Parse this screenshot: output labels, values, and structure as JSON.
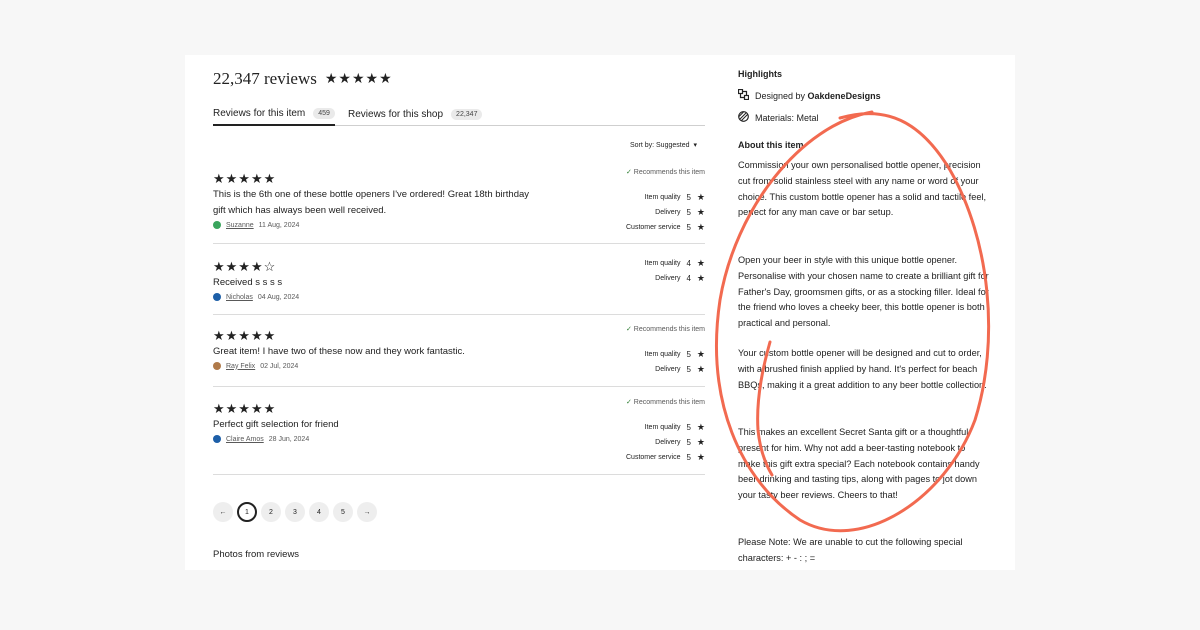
{
  "reviews": {
    "total_label": "22,347 reviews",
    "total_stars": "★★★★★",
    "tabs": [
      {
        "label": "Reviews for this item",
        "count": "459"
      },
      {
        "label": "Reviews for this shop",
        "count": "22,347"
      }
    ],
    "sort_label": "Sort by: Suggested",
    "sort_icon": "▾",
    "items": [
      {
        "stars": "★★★★★",
        "text": "This is the 6th one of these bottle openers I've ordered! Great 18th birthday gift which has always been well received.",
        "author": "Suzanne",
        "date": "11 Aug, 2024",
        "recommends": "Recommends this item",
        "ratings": [
          {
            "label": "Item quality",
            "value": "5"
          },
          {
            "label": "Delivery",
            "value": "5"
          },
          {
            "label": "Customer service",
            "value": "5"
          }
        ]
      },
      {
        "stars": "★★★★☆",
        "text": "Received s s s s",
        "author": "Nicholas",
        "date": "04 Aug, 2024",
        "ratings": [
          {
            "label": "Item quality",
            "value": "4"
          },
          {
            "label": "Delivery",
            "value": "4"
          }
        ]
      },
      {
        "stars": "★★★★★",
        "text": "Great item! I have two of these now and they work fantastic.",
        "author": "Ray Felix",
        "date": "02 Jul, 2024",
        "recommends": "Recommends this item",
        "ratings": [
          {
            "label": "Item quality",
            "value": "5"
          },
          {
            "label": "Delivery",
            "value": "5"
          }
        ]
      },
      {
        "stars": "★★★★★",
        "text": "Perfect gift selection for friend",
        "author": "Claire Amos",
        "date": "28 Jun, 2024",
        "recommends": "Recommends this item",
        "ratings": [
          {
            "label": "Item quality",
            "value": "5"
          },
          {
            "label": "Delivery",
            "value": "5"
          },
          {
            "label": "Customer service",
            "value": "5"
          }
        ]
      }
    ],
    "rating_star": "★",
    "check": "✓",
    "pagination": {
      "prev": "←",
      "pages": [
        "1",
        "2",
        "3",
        "4",
        "5"
      ],
      "next": "→",
      "current": "1"
    },
    "photos_title": "Photos from reviews"
  },
  "highlights": {
    "title": "Highlights",
    "designed_by_prefix": "Designed by ",
    "designer": "OakdeneDesigns",
    "materials": "Materials: Metal",
    "designer_icon": "designer-icon",
    "materials_icon": "materials-icon"
  },
  "about": {
    "title": "About this item",
    "paragraphs": [
      "Commission your own personalised bottle opener, precision cut from solid stainless steel with any name or word of your choice. This custom bottle opener has a solid and tactile feel, perfect for any man cave or bar setup.",
      "Open your beer in style with this unique bottle opener. Personalise with your chosen name to create a brilliant gift for Father's Day, groomsmen gifts, or as a stocking filler. Ideal for the friend who loves a cheeky beer, this bottle opener is both practical and personal.",
      "Your custom bottle opener will be designed and cut to order, with a brushed finish applied by hand. It's perfect for beach BBQs, making it a great addition to any beer bottle collection.",
      "This makes an excellent Secret Santa gift or a thoughtful present for him. Why not add a beer-tasting notebook to make this gift extra special? Each notebook contains handy beer-drinking and tasting tips, along with pages to jot down your tasty beer reviews. Cheers to that!",
      "Please Note: We are unable to cut the following special characters: + - : ; ="
    ]
  },
  "colors": {
    "annotation": "#f26a50",
    "avatars": [
      "#3aa55d",
      "#1d5fa8",
      "#b07a4a",
      "#1d5fa8"
    ]
  }
}
